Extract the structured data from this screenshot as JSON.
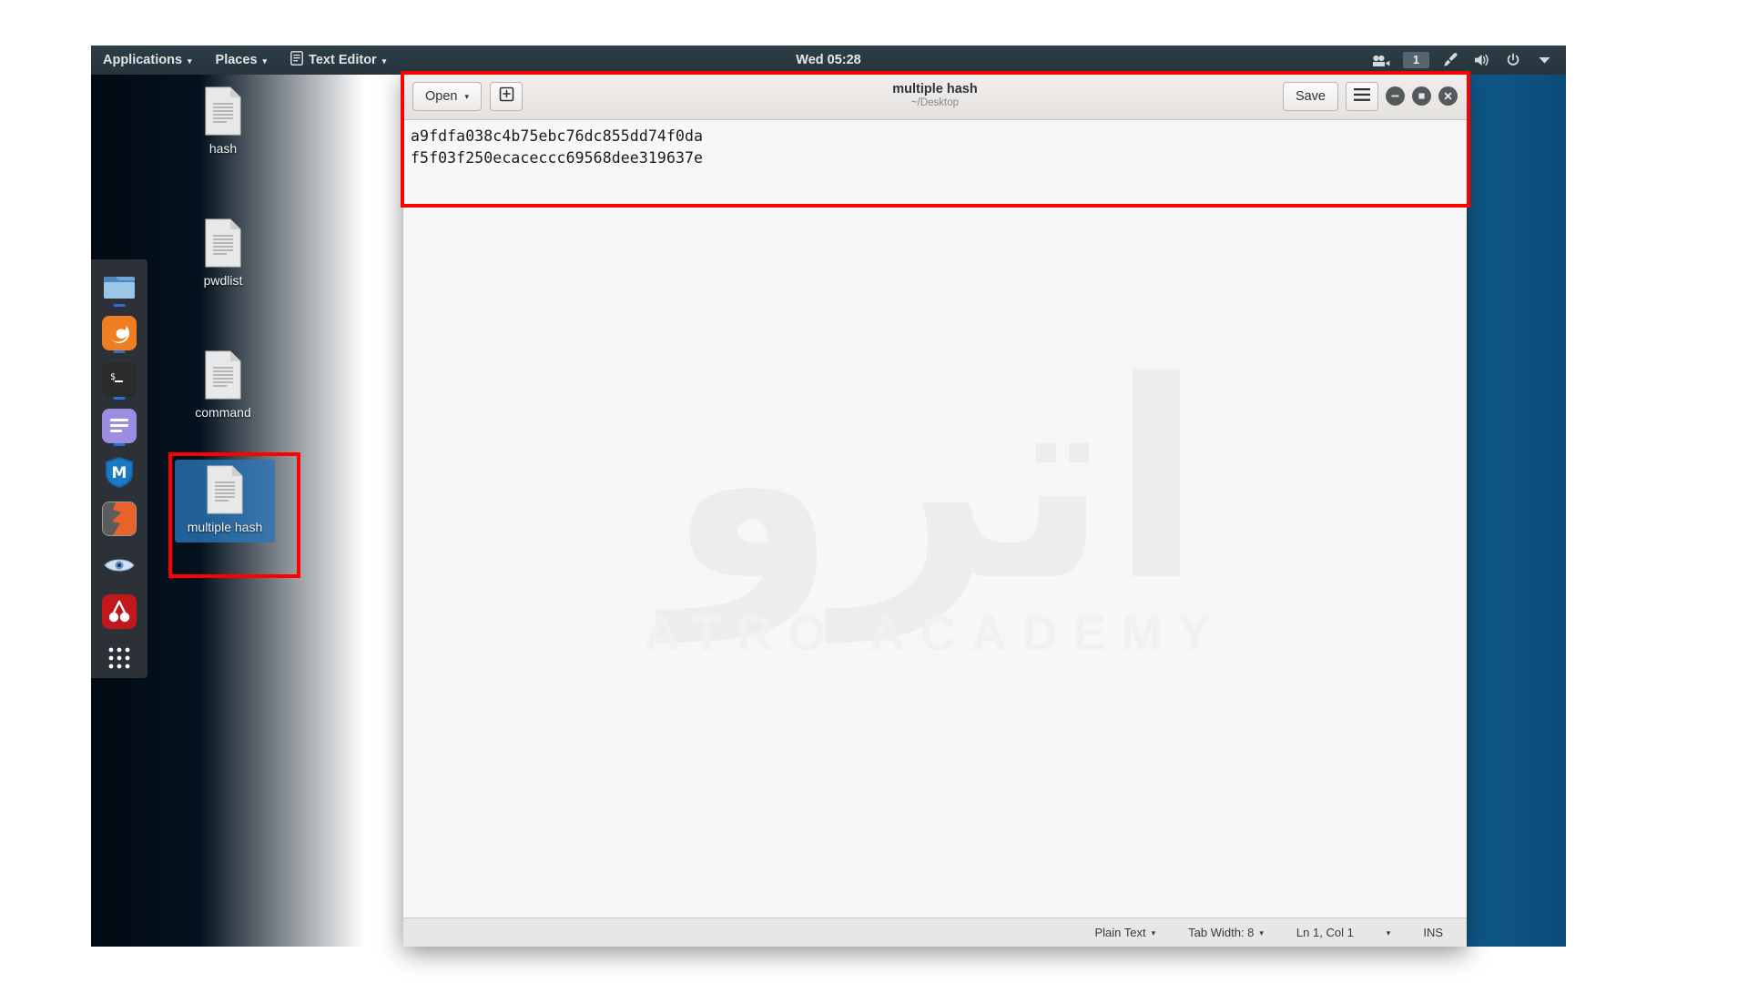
{
  "panel": {
    "menus": [
      {
        "label": "Applications",
        "icon": "none",
        "caret": "▾"
      },
      {
        "label": "Places",
        "icon": "none",
        "caret": "▾"
      },
      {
        "label": "Text Editor",
        "icon": "text-editor-icon",
        "caret": "▾"
      }
    ],
    "clock": "Wed 05:28",
    "workspace": "1",
    "tray_icons": [
      "screen-recorder-icon",
      "workspace-indicator",
      "tweak-brush-icon",
      "volume-icon",
      "power-icon",
      "chevron-down-icon"
    ]
  },
  "dock": {
    "items": [
      {
        "name": "files-manager",
        "label": "Files",
        "color": "#7fb3e0",
        "running": true
      },
      {
        "name": "firefox",
        "label": "Firefox",
        "color": "#ef7d21",
        "running": true
      },
      {
        "name": "terminal",
        "label": "Terminal",
        "color": "#2b2b2b",
        "glyph": "$_",
        "running": true
      },
      {
        "name": "text-editor",
        "label": "Text Editor",
        "color": "#9b8ee0",
        "running": true
      },
      {
        "name": "metasploit",
        "label": "Metasploit Framework",
        "color": "#1565a8",
        "running": false
      },
      {
        "name": "burp-suite",
        "label": "Burp Suite",
        "color": "#e8622a",
        "running": false
      },
      {
        "name": "wireshark",
        "label": "Wireshark",
        "color": "#9fc5e8",
        "running": false
      },
      {
        "name": "john-the-ripper",
        "label": "John the Ripper",
        "color": "#c1181d",
        "running": false
      },
      {
        "name": "show-applications",
        "label": "Show Applications",
        "color": "#2b3137",
        "running": false
      }
    ]
  },
  "desktop": {
    "icons": [
      {
        "name": "hash",
        "label": "hash",
        "selected": false
      },
      {
        "name": "pwdlist",
        "label": "pwdlist",
        "selected": false
      },
      {
        "name": "command",
        "label": "command",
        "selected": false
      },
      {
        "name": "multiple-hash",
        "label": "multiple hash",
        "selected": true
      }
    ]
  },
  "editor": {
    "open_button": "Open",
    "open_caret": "▾",
    "new_doc_icon": "new-document-icon",
    "title": "multiple hash",
    "subtitle": "~/Desktop",
    "save_button": "Save",
    "menu_icon": "hamburger-menu-icon",
    "window_buttons": [
      "minimize-button",
      "maximize-button",
      "close-button"
    ],
    "content": "a9fdfa038c4b75ebc76dc855dd74f0da\nf5f03f250ecaceccc69568dee319637e",
    "watermark_text": "ATRO ACADEMY",
    "statusbar": {
      "language": "Plain Text",
      "language_caret": "▾",
      "tab_width": "Tab Width: 8",
      "tab_caret": "▾",
      "position": "Ln 1, Col 1",
      "position_caret": "▾",
      "insert_mode": "INS"
    }
  },
  "annotations": {
    "accent_color": "#ff0000",
    "boxes": [
      "editor-window-highlight",
      "multiple-hash-icon-highlight"
    ]
  }
}
